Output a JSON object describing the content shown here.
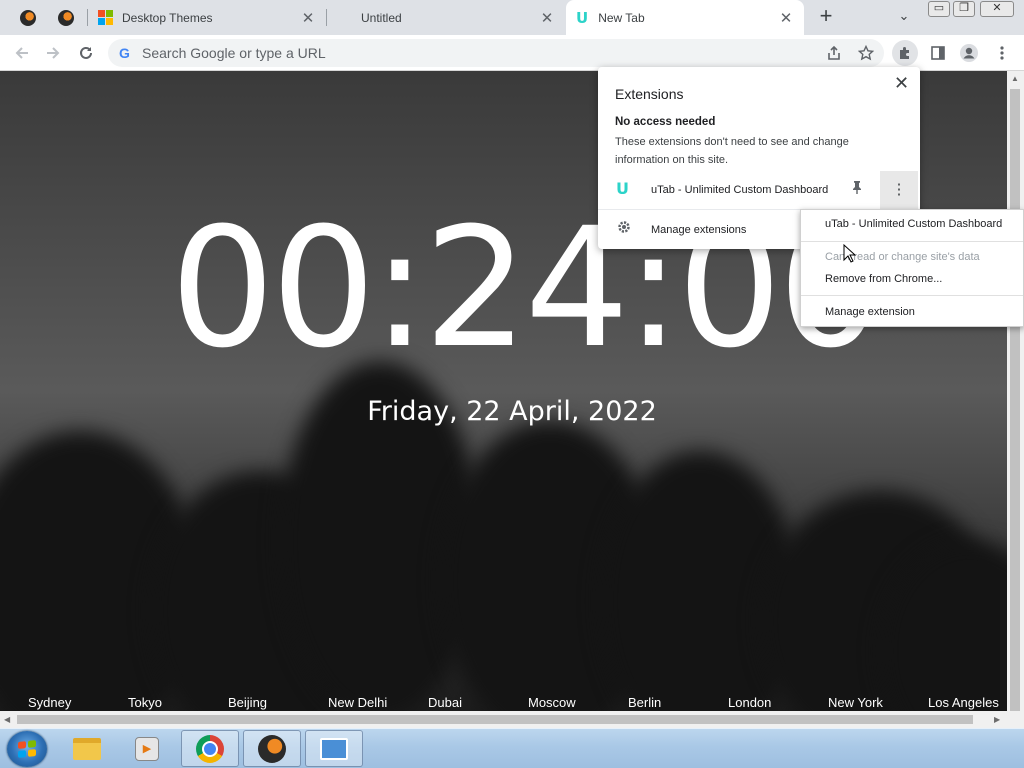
{
  "tabs": {
    "pinned": [
      {
        "icon": "bird-app-icon"
      },
      {
        "icon": "bird-app-icon"
      }
    ],
    "items": [
      {
        "title": "Desktop Themes",
        "icon": "microsoft-logo-icon",
        "active": false
      },
      {
        "title": "Untitled",
        "icon": "",
        "active": false
      },
      {
        "title": "New Tab",
        "icon": "utab-icon",
        "active": true
      }
    ],
    "new_tab_symbol": "+",
    "close_symbol": "✕",
    "tab_search_symbol": "⌄"
  },
  "window_controls": {
    "minimize": "▭",
    "restore": "❐",
    "close": "✕"
  },
  "toolbar": {
    "omnibox_placeholder": "Search Google or type a URL",
    "google_letter": "G"
  },
  "page": {
    "clock": "00:24:00",
    "date": "Friday, 22 April, 2022",
    "cities": [
      "Sydney",
      "Tokyo",
      "Beijing",
      "New Delhi",
      "Dubai",
      "Moscow",
      "Berlin",
      "London",
      "New York",
      "Los Angeles"
    ]
  },
  "extensions_popup": {
    "title": "Extensions",
    "section_title": "No access needed",
    "description": "These extensions don't need to see and change information on this site.",
    "extension_name": "uTab - Unlimited Custom Dashboard",
    "manage_label": "Manage extensions",
    "close_symbol": "✕",
    "more_symbol": "⋮",
    "icon_letter": "U"
  },
  "context_menu": {
    "items": [
      {
        "label": "uTab - Unlimited Custom Dashboard",
        "disabled": false
      },
      {
        "label": "Can't read or change site's data",
        "disabled": true
      },
      {
        "label": "Remove from Chrome...",
        "disabled": false
      },
      {
        "label": "Manage extension",
        "disabled": false
      }
    ]
  },
  "taskbar": {
    "apps": [
      "windows-explorer",
      "media-player",
      "google-chrome",
      "bird-app",
      "control-panel"
    ],
    "active_app": "google-chrome"
  },
  "colors": {
    "accent_teal": "#2cd3c9",
    "tabstrip_bg": "#dee1e6",
    "taskbar_bg": "#a9c8e6"
  }
}
